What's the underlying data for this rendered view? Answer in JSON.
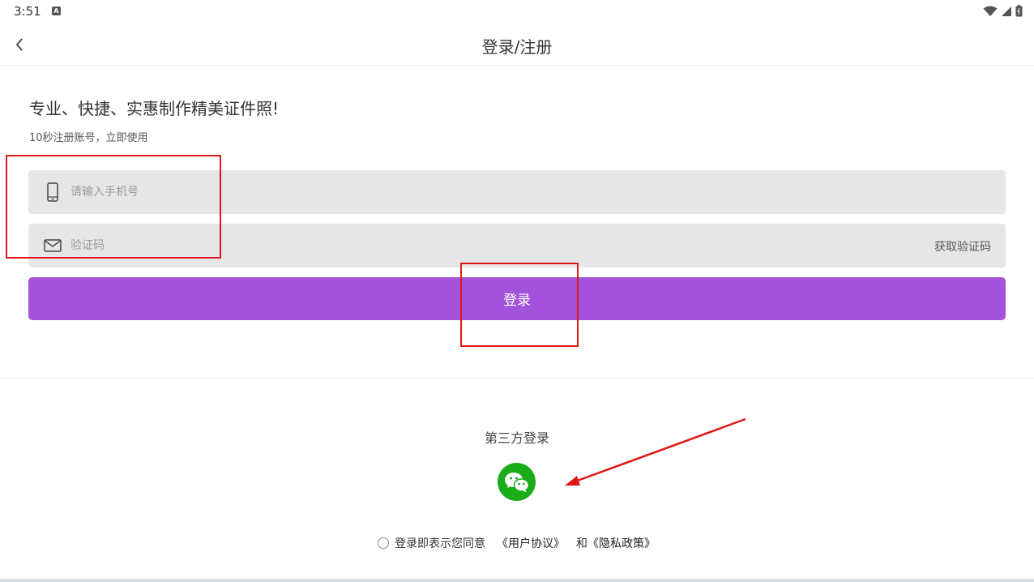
{
  "status_bar": {
    "time": "3:51",
    "notification_icon": "a-square-icon",
    "icons": [
      "wifi-icon",
      "signal-icon",
      "battery-icon"
    ]
  },
  "app_bar": {
    "back_icon": "chevron-left-icon",
    "title": "登录/注册"
  },
  "intro": {
    "headline": "专业、快捷、实惠制作精美证件照!",
    "subline": "10秒注册账号，立即使用"
  },
  "form": {
    "phone": {
      "icon": "phone-icon",
      "placeholder": "请输入手机号",
      "value": ""
    },
    "code": {
      "icon": "mail-icon",
      "placeholder": "验证码",
      "value": "",
      "get_code_label": "获取验证码"
    },
    "login_label": "登录"
  },
  "third_party": {
    "title": "第三方登录",
    "wechat_icon": "wechat-icon"
  },
  "agreement": {
    "checked": false,
    "prefix": "登录即表示您同意",
    "user_agreement": "《用户协议》",
    "conjunction": "和",
    "privacy_policy": "《隐私政策》"
  },
  "colors": {
    "primary": "#a352dc",
    "field_bg": "#e6e6e6",
    "wechat": "#1aad19",
    "annotation": "#e01818"
  }
}
